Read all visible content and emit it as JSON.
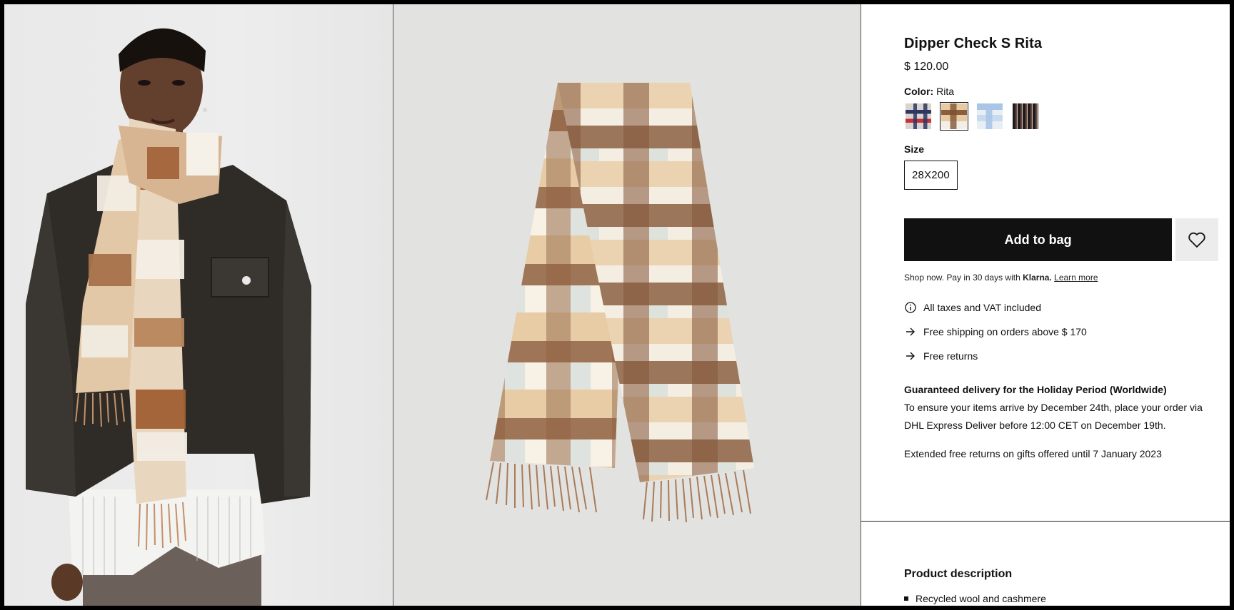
{
  "product": {
    "title": "Dipper Check S Rita",
    "price": "$ 120.00",
    "color_label": "Color:",
    "color_value": "Rita",
    "swatches": [
      {
        "name": "navy-red check",
        "colors": [
          "#2d3763",
          "#c9303a",
          "#d9d4cf"
        ]
      },
      {
        "name": "rita",
        "colors": [
          "#7a4e2e",
          "#e7c9a2",
          "#f4efe6"
        ],
        "selected": true
      },
      {
        "name": "light blue check",
        "colors": [
          "#a9c6e6",
          "#e9eef5",
          "#c8daef"
        ]
      },
      {
        "name": "dark check",
        "colors": [
          "#1f1b1e",
          "#6a4a3e",
          "#d6c3b9"
        ]
      }
    ],
    "size_label": "Size",
    "size_value": "28X200"
  },
  "actions": {
    "add_to_bag": "Add to bag"
  },
  "klarna": {
    "prefix": "Shop now. Pay in 30 days with ",
    "brand": "Klarna.",
    "link": "Learn more"
  },
  "perks": [
    {
      "icon": "info-icon",
      "text": "All taxes and VAT included"
    },
    {
      "icon": "arrow-right-icon",
      "text": "Free shipping on orders above $ 170"
    },
    {
      "icon": "arrow-right-icon",
      "text": "Free returns"
    }
  ],
  "notice": {
    "heading": "Guaranteed delivery for the Holiday Period (Worldwide)",
    "line1": "To ensure your items arrive by December 24th, place your order via",
    "line2": "DHL Express Deliver before 12:00 CET on December 19th."
  },
  "extended_returns": "Extended free returns on gifts offered until 7 January 2023",
  "description": {
    "title": "Product description",
    "toggle": "−",
    "bullets": [
      "Recycled wool and cashmere"
    ]
  },
  "colors": {
    "cta_bg": "#111111",
    "wishlist_bg": "#ececec",
    "image_bg": "#e2e2e1"
  }
}
